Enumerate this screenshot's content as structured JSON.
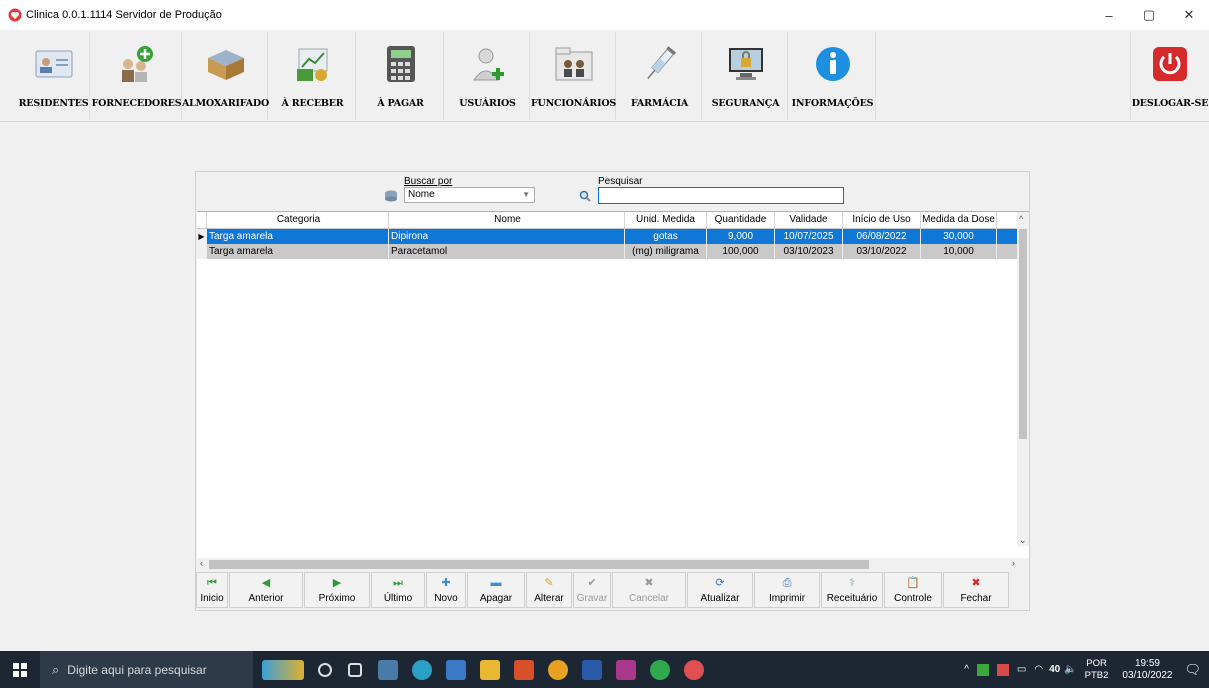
{
  "window": {
    "title": "Clinica 0.0.1.1114 Servidor de Produção",
    "minimize": "–",
    "maximize": "▢",
    "close": "✕"
  },
  "toolbar": {
    "residentes": "RESIDENTES",
    "fornecedores": "FORNECEDORES",
    "almoxarifado": "ALMOXARIFADO",
    "a_receber": "À RECEBER",
    "a_pagar": "À PAGAR",
    "usuarios": "USUÁRIOS",
    "funcionarios": "FUNCIONÁRIOS",
    "farmacia": "FARMÁCIA",
    "seguranca": "SEGURANÇA",
    "informacoes": "INFORMAÇÕES",
    "deslogar": "DESLOGAR-SE"
  },
  "search": {
    "buscar_por_label": "Buscar por",
    "buscar_por_value": "Nome",
    "pesquisar_label": "Pesquisar",
    "pesquisar_value": ""
  },
  "grid": {
    "headers": {
      "categoria": "Categoria",
      "nome": "Nome",
      "unid": "Unid. Medida",
      "quantidade": "Quantidade",
      "validade": "Validade",
      "inicio": "Início de Uso",
      "dose": "Medida da Dose"
    },
    "rows": [
      {
        "categoria": "Targa amarela",
        "nome": "Dipirona",
        "unid": "gotas",
        "quantidade": "9,000",
        "validade": "10/07/2025",
        "inicio": "06/08/2022",
        "dose": "30,000"
      },
      {
        "categoria": "Targa amarela",
        "nome": "Paracetamol",
        "unid": "(mg) miligrama",
        "quantidade": "100,000",
        "validade": "03/10/2023",
        "inicio": "03/10/2022",
        "dose": "10,000"
      }
    ]
  },
  "buttons": {
    "inicio": "Inicio",
    "anterior": "Anterior",
    "proximo": "Próximo",
    "ultimo": "Último",
    "novo": "Novo",
    "apagar": "Apagar",
    "alterar": "Alterar",
    "gravar": "Gravar",
    "cancelar": "Cancelar",
    "atualizar": "Atualizar",
    "imprimir": "Imprimir",
    "receituario": "Receituário",
    "controle": "Controle",
    "fechar": "Fechar"
  },
  "taskbar": {
    "search_placeholder": "Digite aqui para pesquisar",
    "lang1": "POR",
    "lang2": "PTB2",
    "time": "19:59",
    "date": "03/10/2022",
    "temp": "40"
  },
  "colors": {
    "selected_row": "#0f78d7",
    "alt_row": "#c9c9c9",
    "taskbar": "#1c2733"
  }
}
